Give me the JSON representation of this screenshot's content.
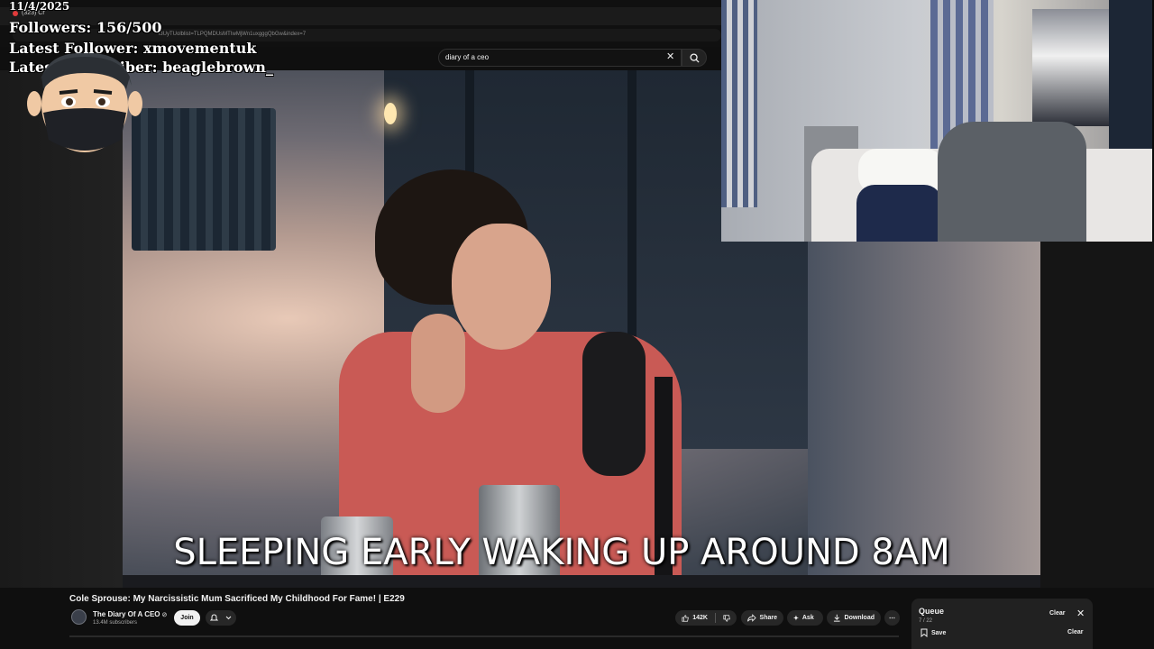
{
  "browser": {
    "tab_label": "(323) Cr",
    "url": "i3UyTUolblist=TLPQMDUsMTIwMjWn1uxgggQbGw&index=7"
  },
  "search": {
    "query": "diary of a ceo",
    "clear_icon": "close-icon",
    "search_icon": "search-icon"
  },
  "overlay": {
    "date": "11/4/2025",
    "followers": "Followers: 156/500",
    "latest_follower": "Latest Follower: xmovementuk",
    "latest_subscriber": "Latest Subscriber: beaglebrown_"
  },
  "video": {
    "caption": "SLEEPING EARLY WAKING UP AROUND 8AM"
  },
  "info": {
    "title": "Cole Sprouse: My Narcissistic Mum Sacrificed My Childhood For Fame! | E229",
    "channel_name": "The Diary Of A CEO",
    "channel_verified_icon": "verified-icon",
    "subscribers": "13.4M subscribers",
    "join_label": "Join",
    "like_count": "142K",
    "share_label": "Share",
    "ask_label": "Ask",
    "download_label": "Download",
    "more_glyph": "⋯"
  },
  "queue": {
    "title": "Queue",
    "count": "7 / 22",
    "clear_top": "Clear",
    "save_label": "Save",
    "clear_bottom": "Clear"
  },
  "colors": {
    "yt_background": "#0f0f0f",
    "pill_background": "#272727",
    "caption_text": "#ffffff",
    "live_dot": "#e03b3b"
  }
}
